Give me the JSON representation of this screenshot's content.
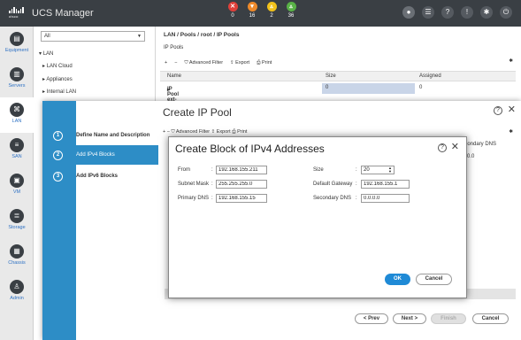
{
  "header": {
    "logo_text": "cisco",
    "app_title": "UCS Manager",
    "faults": [
      {
        "icon": "critical-fault-icon",
        "count": "0",
        "color": "#e0403a",
        "glyph": "✕"
      },
      {
        "icon": "major-fault-icon",
        "count": "16",
        "color": "#ee8a2b",
        "glyph": "▾"
      },
      {
        "icon": "minor-fault-icon",
        "count": "2",
        "color": "#f2c21b",
        "glyph": "▵"
      },
      {
        "icon": "warning-fault-icon",
        "count": "36",
        "color": "#59b247",
        "glyph": "▵"
      }
    ]
  },
  "nav": {
    "items": [
      {
        "label": "Equipment",
        "icon": "equipment-icon"
      },
      {
        "label": "Servers",
        "icon": "servers-icon"
      },
      {
        "label": "LAN",
        "icon": "lan-icon"
      },
      {
        "label": "SAN",
        "icon": "san-icon"
      },
      {
        "label": "VM",
        "icon": "vm-icon"
      },
      {
        "label": "Storage",
        "icon": "storage-icon"
      },
      {
        "label": "Chassis",
        "icon": "chassis-icon"
      },
      {
        "label": "Admin",
        "icon": "admin-icon"
      }
    ]
  },
  "tree": {
    "filter_value": "All",
    "items": [
      "LAN",
      "LAN Cloud",
      "Appliances",
      "Internal LAN"
    ]
  },
  "content": {
    "breadcrumb": "LAN / Pools / root / IP Pools",
    "section_title": "IP Pools",
    "toolbar": {
      "add": "+",
      "remove": "−",
      "filter": "Advanced Filter",
      "export": "Export",
      "print": "Print"
    },
    "columns": [
      "Name",
      "Size",
      "Assigned"
    ],
    "rows": [
      {
        "name": "IP Pool ext-mgmt",
        "size": "0",
        "assigned": "0"
      }
    ]
  },
  "wizard": {
    "title": "Create IP Pool",
    "steps": [
      {
        "num": "1",
        "label": "Define Name and Description"
      },
      {
        "num": "2",
        "label": "Add IPv4 Blocks"
      },
      {
        "num": "3",
        "label": "Add IPv6 Blocks"
      }
    ],
    "toolbar": {
      "add": "+",
      "remove": "−",
      "filter": "Advanced Filter",
      "export": "Export",
      "print": "Print"
    },
    "right_col_header": "Secondary DNS",
    "right_col_value": "0.0.0.0",
    "buttons": {
      "prev": "< Prev",
      "next": "Next >",
      "finish": "Finish",
      "cancel": "Cancel"
    }
  },
  "dialog": {
    "title": "Create Block of IPv4 Addresses",
    "fields": {
      "from_label": "From",
      "from_value": "192.168.155.211",
      "size_label": "Size",
      "size_value": "20",
      "subnet_label": "Subnet Mask",
      "subnet_value": "255.255.255.0",
      "gateway_label": "Default Gateway",
      "gateway_value": "192.168.155.1",
      "pdns_label": "Primary DNS",
      "pdns_value": "192.168.155.15",
      "sdns_label": "Secondary DNS",
      "sdns_value": "0.0.0.0"
    },
    "ok": "OK",
    "cancel": "Cancel"
  }
}
